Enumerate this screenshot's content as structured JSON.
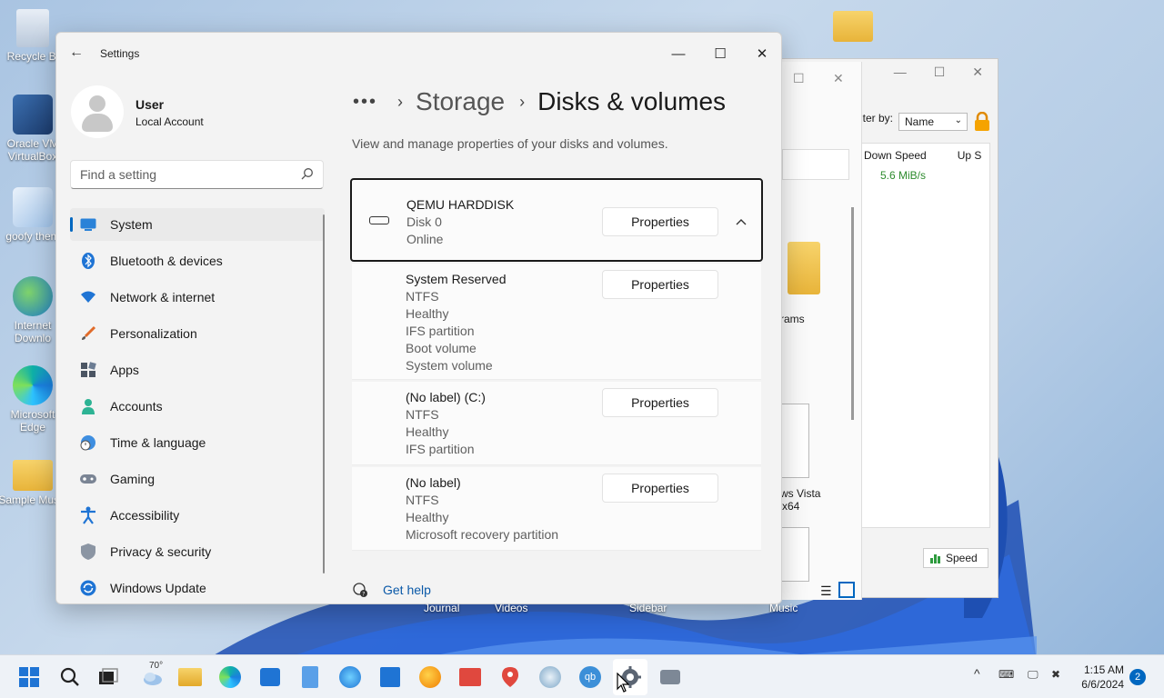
{
  "desktop": {
    "icons": [
      {
        "label": "Recycle Bi",
        "icon": "recycle-bin-icon"
      },
      {
        "label": "Oracle VM VirtualBox",
        "icon": "virtualbox-icon"
      },
      {
        "label": "goofy them",
        "icon": "theme-files-icon"
      },
      {
        "label": "Internet Downlo",
        "icon": "internet-download-manager-icon"
      },
      {
        "label": "Microsoft Edge",
        "icon": "edge-icon"
      },
      {
        "label": "Sample Music",
        "icon": "folder-icon"
      }
    ],
    "under_labels": [
      "Journal",
      "Videos",
      "Sidebar",
      "Music"
    ]
  },
  "back_window": {
    "filter_label": "lter by:",
    "filter_value": "Name",
    "col_down": "Down Speed",
    "col_up": "Up S",
    "down_speed_value": "5.6 MiB/s",
    "speed_button": "Speed"
  },
  "explorer_partial": {
    "label_programs": "rams",
    "label_vista": "ws Vista",
    "label_x64": "x64"
  },
  "settings": {
    "window_title": "Settings",
    "user": {
      "name": "User",
      "account": "Local Account"
    },
    "search_placeholder": "Find a setting",
    "nav": [
      {
        "label": "System",
        "icon": "system-display-icon",
        "active": true
      },
      {
        "label": "Bluetooth & devices",
        "icon": "bluetooth-icon"
      },
      {
        "label": "Network & internet",
        "icon": "wifi-icon"
      },
      {
        "label": "Personalization",
        "icon": "brush-icon"
      },
      {
        "label": "Apps",
        "icon": "apps-icon"
      },
      {
        "label": "Accounts",
        "icon": "accounts-icon"
      },
      {
        "label": "Time & language",
        "icon": "globe-clock-icon"
      },
      {
        "label": "Gaming",
        "icon": "gamepad-icon"
      },
      {
        "label": "Accessibility",
        "icon": "accessibility-icon"
      },
      {
        "label": "Privacy & security",
        "icon": "shield-icon"
      },
      {
        "label": "Windows Update",
        "icon": "windows-update-icon"
      }
    ],
    "breadcrumb": {
      "more": "•••",
      "parent": "Storage",
      "current": "Disks & volumes"
    },
    "description": "View and manage properties of your disks and volumes.",
    "disk": {
      "name": "QEMU HARDDISK",
      "number": "Disk 0",
      "status": "Online",
      "button": "Properties"
    },
    "volumes": [
      {
        "lines": [
          "System Reserved",
          "NTFS",
          "Healthy",
          "IFS partition",
          "Boot volume",
          "System volume"
        ],
        "button": "Properties"
      },
      {
        "lines": [
          "(No label) (C:)",
          "NTFS",
          "Healthy",
          "IFS partition"
        ],
        "button": "Properties"
      },
      {
        "lines": [
          "(No label)",
          "NTFS",
          "Healthy",
          "Microsoft recovery partition"
        ],
        "button": "Properties"
      }
    ],
    "help_link": "Get help"
  },
  "taskbar": {
    "weather_temp": "70°",
    "time": "1:15 AM",
    "date": "6/6/2024",
    "notification_count": "2",
    "accent": "#0067c0"
  }
}
